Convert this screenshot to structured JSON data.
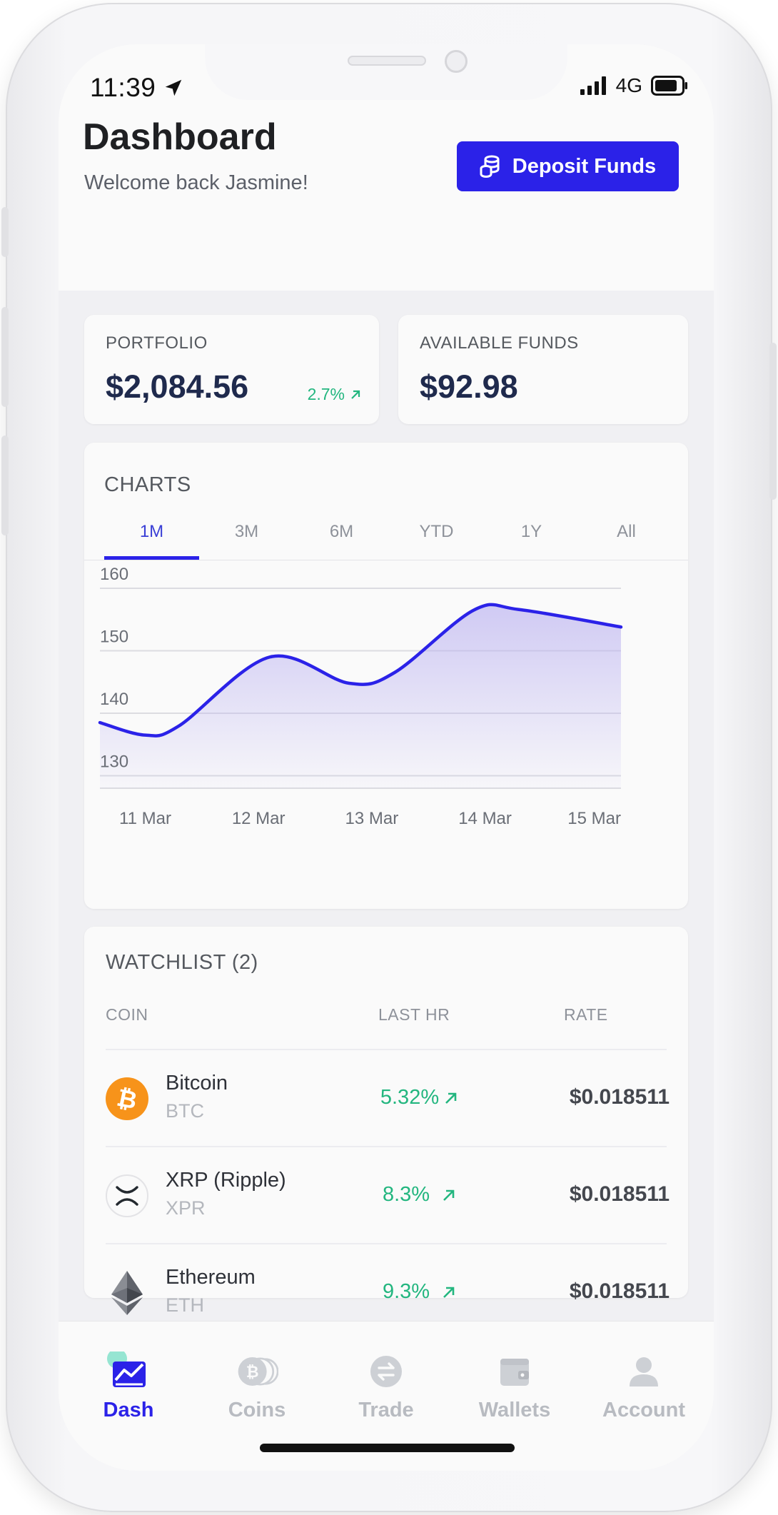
{
  "status_bar": {
    "time": "11:39",
    "network": "4G"
  },
  "header": {
    "title": "Dashboard",
    "subtitle": "Welcome back Jasmine!",
    "deposit_label": "Deposit Funds"
  },
  "portfolio": {
    "label": "PORTFOLIO",
    "value": "$2,084.56",
    "change": "2.7%"
  },
  "available_funds": {
    "label": "AVAILABLE FUNDS",
    "value": "$92.98"
  },
  "charts": {
    "title": "CHARTS",
    "tabs": [
      "1M",
      "3M",
      "6M",
      "YTD",
      "1Y",
      "All"
    ],
    "active_tab": "1M"
  },
  "chart_data": {
    "type": "area",
    "title": "",
    "xlabel": "",
    "ylabel": "",
    "x": [
      10.6,
      11.0,
      11.3,
      12.1,
      12.8,
      13.2,
      13.9,
      14.3,
      15.2
    ],
    "y": [
      138.5,
      136.5,
      138.0,
      149.0,
      144.8,
      146.5,
      156.5,
      156.6,
      153.8
    ],
    "x_ticks": [
      11,
      12,
      13,
      14,
      15
    ],
    "x_tick_labels": [
      "11 Mar",
      "12 Mar",
      "13 Mar",
      "14 Mar",
      "15 Mar"
    ],
    "y_ticks": [
      130,
      140,
      150,
      160
    ],
    "y_tick_labels": [
      "130",
      "140",
      "150",
      "160"
    ],
    "xlim": [
      10.6,
      15.2
    ],
    "ylim": [
      128,
      160
    ],
    "grid": true,
    "line_color": "#2b22e8",
    "fill_color": "#b9b0f0"
  },
  "watchlist": {
    "title": "WATCHLIST (2)",
    "columns": [
      "COIN",
      "LAST HR",
      "RATE"
    ],
    "rows": [
      {
        "name": "Bitcoin",
        "symbol": "BTC",
        "change": "5.32%",
        "rate": "$0.018511",
        "icon": "bitcoin-icon"
      },
      {
        "name": "XRP (Ripple)",
        "symbol": "XPR",
        "change": "8.3%",
        "rate": "$0.018511",
        "icon": "xrp-icon"
      },
      {
        "name": "Ethereum",
        "symbol": "ETH",
        "change": "9.3%",
        "rate": "$0.018511",
        "icon": "ethereum-icon"
      }
    ]
  },
  "nav": {
    "items": [
      {
        "label": "Dash",
        "icon": "chart-icon",
        "active": true
      },
      {
        "label": "Coins",
        "icon": "coins-icon",
        "active": false
      },
      {
        "label": "Trade",
        "icon": "trade-icon",
        "active": false
      },
      {
        "label": "Wallets",
        "icon": "wallet-icon",
        "active": false
      },
      {
        "label": "Account",
        "icon": "account-icon",
        "active": false
      }
    ]
  },
  "colors": {
    "accent": "#2b22e8",
    "positive": "#23b67f",
    "bitcoin": "#f7931a"
  }
}
